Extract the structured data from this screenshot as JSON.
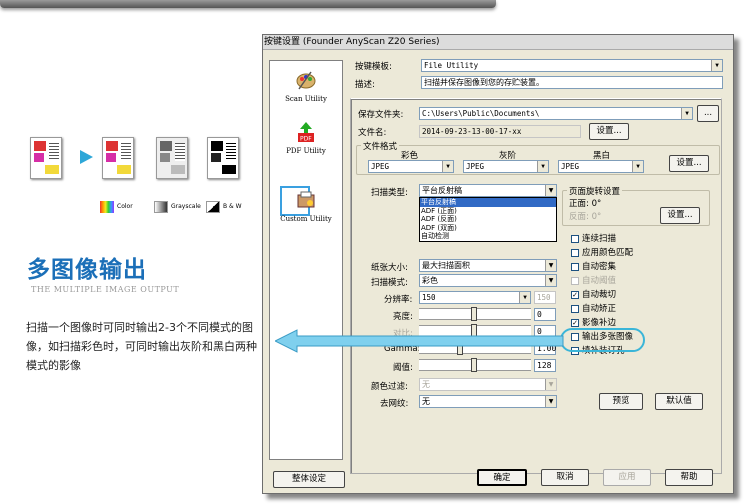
{
  "left_panel": {
    "heading": "多图像输出",
    "subheading": "THE MULTIPLE IMAGE OUTPUT",
    "description": "扫描一个图像时可同时输出2-3个不同模式的图像，如扫描彩色时，可同时输出灰阶和黑白两种模式的影像",
    "legend": [
      "Color",
      "Grayscale",
      "B & W"
    ]
  },
  "dialog": {
    "title": "按键设置 (Founder AnyScan Z20 Series)",
    "utilities": [
      {
        "label": "Scan Utility",
        "icon": "palette-icon"
      },
      {
        "label": "PDF Utility",
        "icon": "pdf-icon"
      },
      {
        "label": "Custom Utility",
        "icon": "custom-icon"
      }
    ],
    "template_label": "按键模板:",
    "template_value": "File Utility",
    "desc_label": "描述:",
    "desc_value": "扫描并保存图像到您的存贮装置。",
    "save_folder_label": "保存文件夹:",
    "save_folder_value": "C:\\Users\\Public\\Documents\\",
    "browse_btn": "...",
    "filename_label": "文件名:",
    "filename_value": "2014-09-23-13-00-17-xx",
    "settings_btn": "设置...",
    "format_group": "文件格式",
    "fmt_headers": [
      "彩色",
      "灰阶",
      "黑白"
    ],
    "fmt_values": [
      "JPEG",
      "JPEG",
      "JPEG"
    ],
    "scan_type_label": "扫描类型:",
    "scan_type_value": "平台反射稿",
    "scan_type_options": [
      "平台反射稿",
      "ADF (正面)",
      "ADF (反面)",
      "ADF (双面)",
      "自动检测"
    ],
    "rotation_group": "页面旋转设置",
    "front_label": "正面: 0°",
    "back_label": "反面: 0°",
    "paper_label": "纸张大小:",
    "paper_value": "最大扫描面积",
    "mode_label": "扫描模式:",
    "mode_value": "彩色",
    "res_label": "分辨率:",
    "res_value": "150",
    "res_spin": "150",
    "bright_label": "亮度:",
    "bright_value": "0",
    "contrast_label": "对比:",
    "contrast_value": "0",
    "gamma_label": "Gamma:",
    "gamma_value": "1.00",
    "threshold_label": "阈值:",
    "threshold_value": "128",
    "filter_label": "颜色过滤:",
    "filter_value": "无",
    "descreen_label": "去网纹:",
    "descreen_value": "无",
    "checkboxes": [
      {
        "label": "连续扫描",
        "checked": false,
        "disabled": false
      },
      {
        "label": "应用颜色匹配",
        "checked": false,
        "disabled": false
      },
      {
        "label": "自动密集",
        "checked": false,
        "disabled": false
      },
      {
        "label": "自动阈值",
        "checked": false,
        "disabled": true
      },
      {
        "label": "自动裁切",
        "checked": true,
        "disabled": false
      },
      {
        "label": "自动矫正",
        "checked": false,
        "disabled": false
      },
      {
        "label": "影像补边",
        "checked": true,
        "disabled": false
      },
      {
        "label": "输出多张图像",
        "checked": false,
        "disabled": false
      },
      {
        "label": "填补装订孔",
        "checked": false,
        "disabled": false
      }
    ],
    "preview_btn": "预览",
    "default_btn": "默认值",
    "global_btn": "整体设定",
    "ok_btn": "确定",
    "cancel_btn": "取消",
    "apply_btn": "应用",
    "help_btn": "帮助"
  },
  "colors": {
    "accent": "#1b6fb8",
    "highlight": "#3ab5d8"
  }
}
